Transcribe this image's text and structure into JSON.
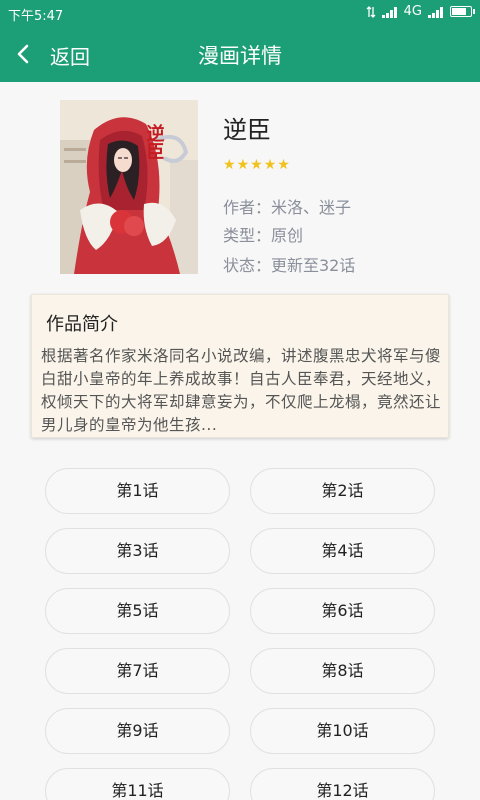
{
  "status_bar": {
    "time": "下午5:47",
    "network": "4G",
    "icons": [
      "data-arrows-icon",
      "signal-icon",
      "network-4g-icon",
      "signal-icon",
      "battery-icon"
    ]
  },
  "app_bar": {
    "back_label": "返回",
    "title": "漫画详情",
    "back_icon": "chevron-left-icon"
  },
  "book": {
    "title": "逆臣",
    "cover_calligraphy": "逆臣",
    "rating_stars": 5,
    "author": "作者：米洛、迷子",
    "type": "类型：原创",
    "status": "状态：更新至32话"
  },
  "intro": {
    "heading": "作品简介",
    "body": "根据著名作家米洛同名小说改编，讲述腹黑忠犬将军与傻白甜小皇帝的年上养成故事！自古人臣奉君，天经地义，权倾天下的大将军却肆意妄为，不仅爬上龙榻，竟然还让男儿身的皇帝为他生孩..."
  },
  "chapters": [
    "第1话",
    "第2话",
    "第3话",
    "第4话",
    "第5话",
    "第6话",
    "第7话",
    "第8话",
    "第9话",
    "第10话",
    "第11话",
    "第12话"
  ],
  "colors": {
    "accent": "#1c9f76",
    "star": "#f1c21b",
    "card_bg": "#faf4ea"
  }
}
